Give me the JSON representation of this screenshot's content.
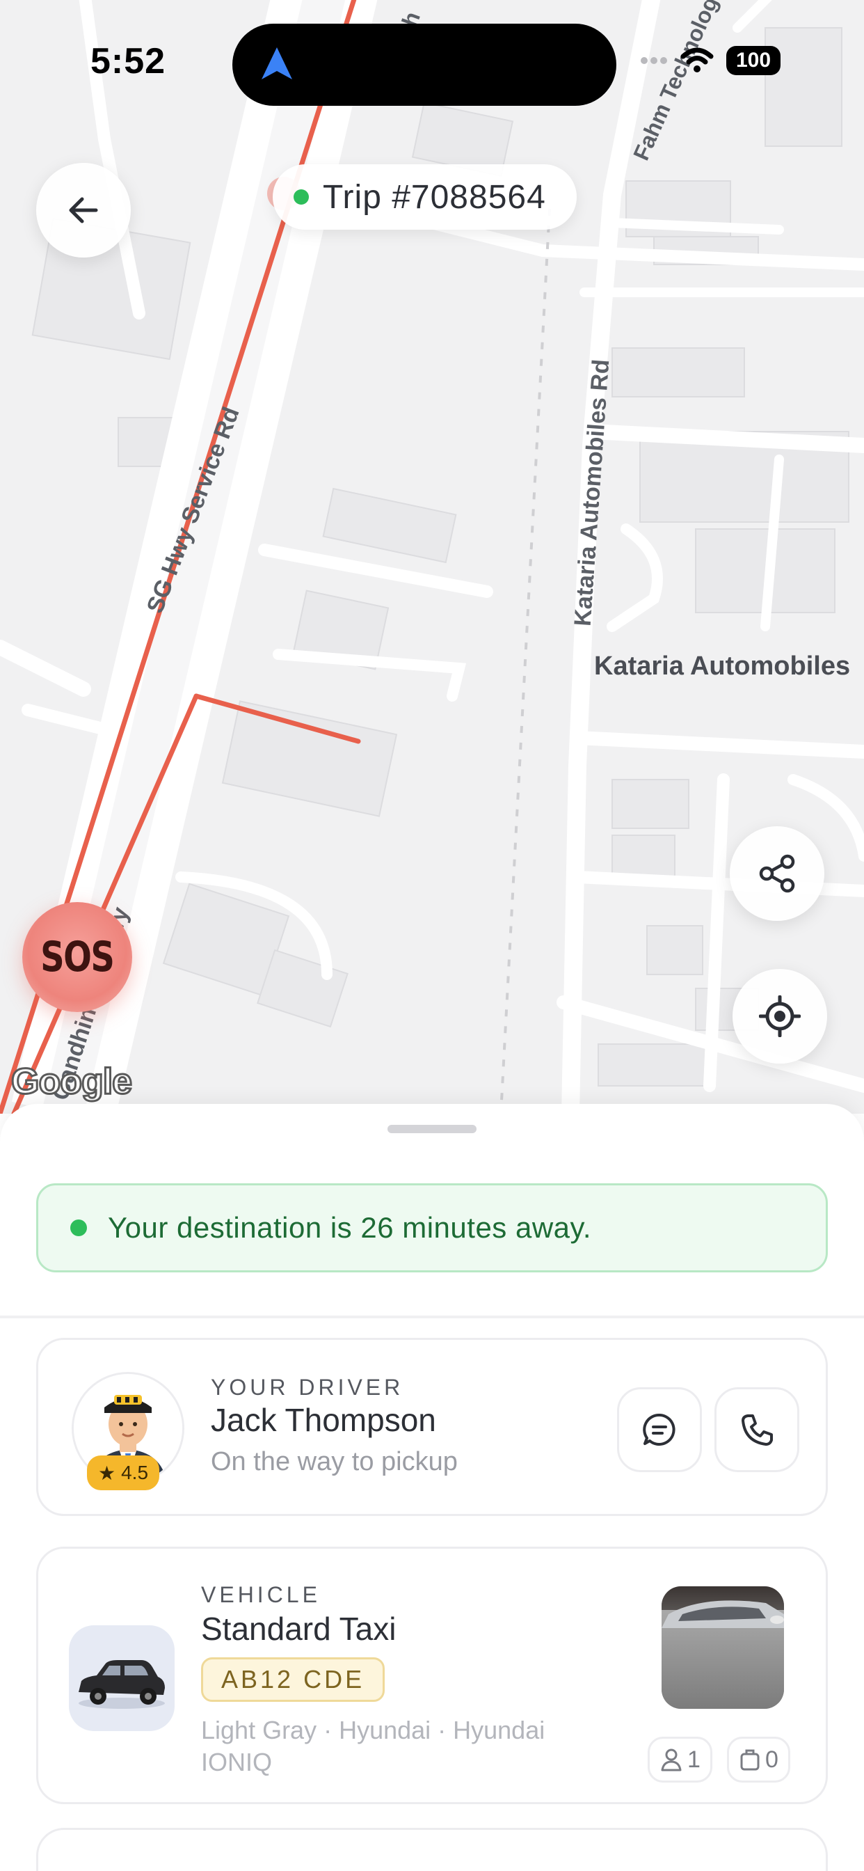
{
  "status_bar": {
    "time": "5:52",
    "battery": "100"
  },
  "map": {
    "road_labels": {
      "sg_hwy": "SG Hwy Service Rd",
      "kataria_rd": "Kataria Automobiles Rd",
      "kataria_place": "Kataria Automobiles",
      "gandhinagar_hwy": "Gandhinagar Hwy",
      "fahm": "Fahm Technologies",
      "top_road": "Kh"
    },
    "attribution": "Google",
    "route_color": "#e8604c"
  },
  "trip": {
    "label": "Trip #7088564"
  },
  "sos": {
    "label": "SOS"
  },
  "eta": {
    "message": "Your destination is 26 minutes away."
  },
  "driver": {
    "overline": "YOUR DRIVER",
    "name": "Jack Thompson",
    "status": "On the way to pickup",
    "rating": "4.5"
  },
  "vehicle": {
    "overline": "VEHICLE",
    "type": "Standard Taxi",
    "plate": "AB12 CDE",
    "description": "Light Gray · Hyundai · Hyundai IONIQ",
    "passengers": "1",
    "luggage": "0"
  },
  "colors": {
    "accent_green": "#2dbd5a",
    "sos_red": "#ee847c",
    "plate_gold": "#efd999",
    "nav_blue": "#3b82f6"
  }
}
